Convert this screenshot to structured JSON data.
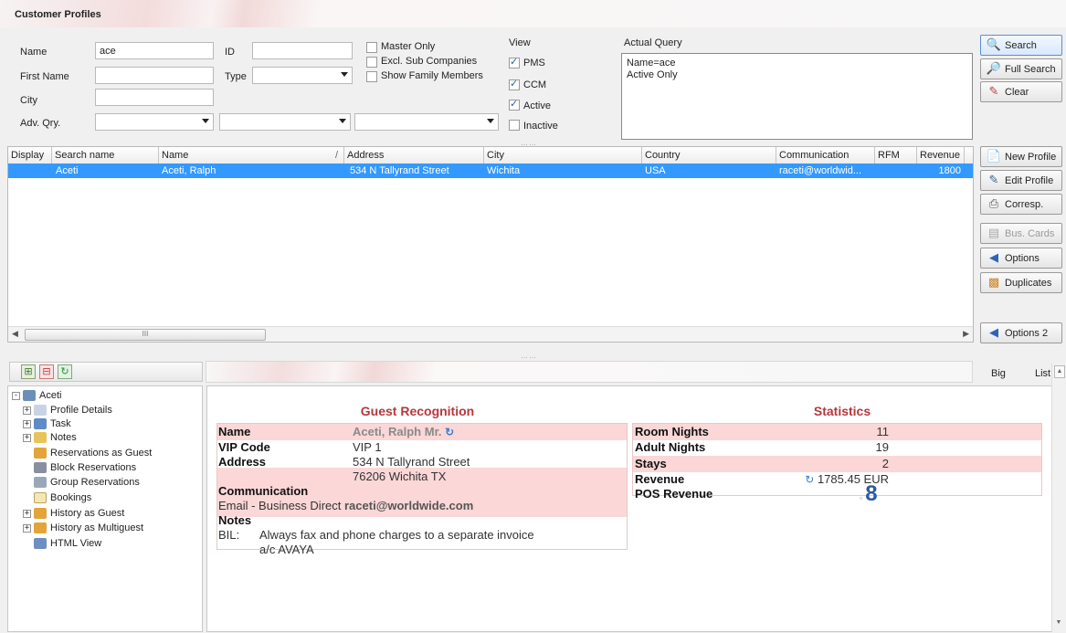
{
  "title": "Customer Profiles",
  "filters": {
    "name_label": "Name",
    "name_value": "ace",
    "first_name_label": "First Name",
    "city_label": "City",
    "adv_qry_label": "Adv. Qry.",
    "id_label": "ID",
    "type_label": "Type",
    "master_only": "Master Only",
    "excl_sub": "Excl. Sub Companies",
    "show_family": "Show Family Members"
  },
  "view": {
    "label": "View",
    "pms": "PMS",
    "ccm": "CCM",
    "active": "Active",
    "inactive": "Inactive"
  },
  "actual_query": {
    "label": "Actual Query",
    "line1": "Name=ace",
    "line2": "Active Only"
  },
  "search_buttons": {
    "search": "Search",
    "full_search": "Full Search",
    "clear": "Clear"
  },
  "grid": {
    "columns": [
      "Display",
      "Search name",
      "Name",
      "Address",
      "City",
      "Country",
      "Communication",
      "RFM",
      "Revenue"
    ],
    "sort_marker": "/",
    "row": {
      "search_name": "Aceti",
      "name": "Aceti, Ralph",
      "address": "534 N Tallyrand Street",
      "city": "Wichita",
      "country": "USA",
      "communication": "raceti@worldwid...",
      "rfm": "",
      "revenue": "1800"
    },
    "scroll_mark": "III"
  },
  "profile_buttons": {
    "new_profile": "New Profile",
    "edit_profile": "Edit Profile",
    "corresp": "Corresp.",
    "bus_cards": "Bus. Cards",
    "options": "Options",
    "duplicates": "Duplicates",
    "options2": "Options 2"
  },
  "view_tabs": {
    "big": "Big",
    "list": "List"
  },
  "tree": {
    "root": "Aceti",
    "items": [
      "Profile Details",
      "Task",
      "Notes",
      "Reservations as Guest",
      "Block Reservations",
      "Group Reservations",
      "Bookings",
      "History as Guest",
      "History as Multiguest",
      "HTML View"
    ]
  },
  "guest_recognition": {
    "heading": "Guest Recognition",
    "name_label": "Name",
    "name_value": "Aceti, Ralph Mr.",
    "vip_label": "VIP Code",
    "vip_value": "VIP 1",
    "address_label": "Address",
    "address_line1": "534 N Tallyrand Street",
    "address_line2": "76206 Wichita TX",
    "communication_label": "Communication",
    "communication_prefix": "Email - Business Direct",
    "communication_value": "raceti@worldwide.com",
    "notes_label": "Notes",
    "notes_code": "BIL:",
    "notes_line1": "Always fax and phone charges to a separate invoice",
    "notes_line2": "a/c AVAYA"
  },
  "statistics": {
    "heading": "Statistics",
    "room_nights_label": "Room Nights",
    "room_nights": "11",
    "adult_nights_label": "Adult Nights",
    "adult_nights": "19",
    "stays_label": "Stays",
    "stays": "2",
    "revenue_label": "Revenue",
    "revenue": "1785.45 EUR",
    "pos_revenue_label": "POS Revenue",
    "pos_revenue": "8"
  },
  "colors": {
    "selection": "#3399ff",
    "band": "#fbd7d7",
    "heading": "#b7373b"
  }
}
